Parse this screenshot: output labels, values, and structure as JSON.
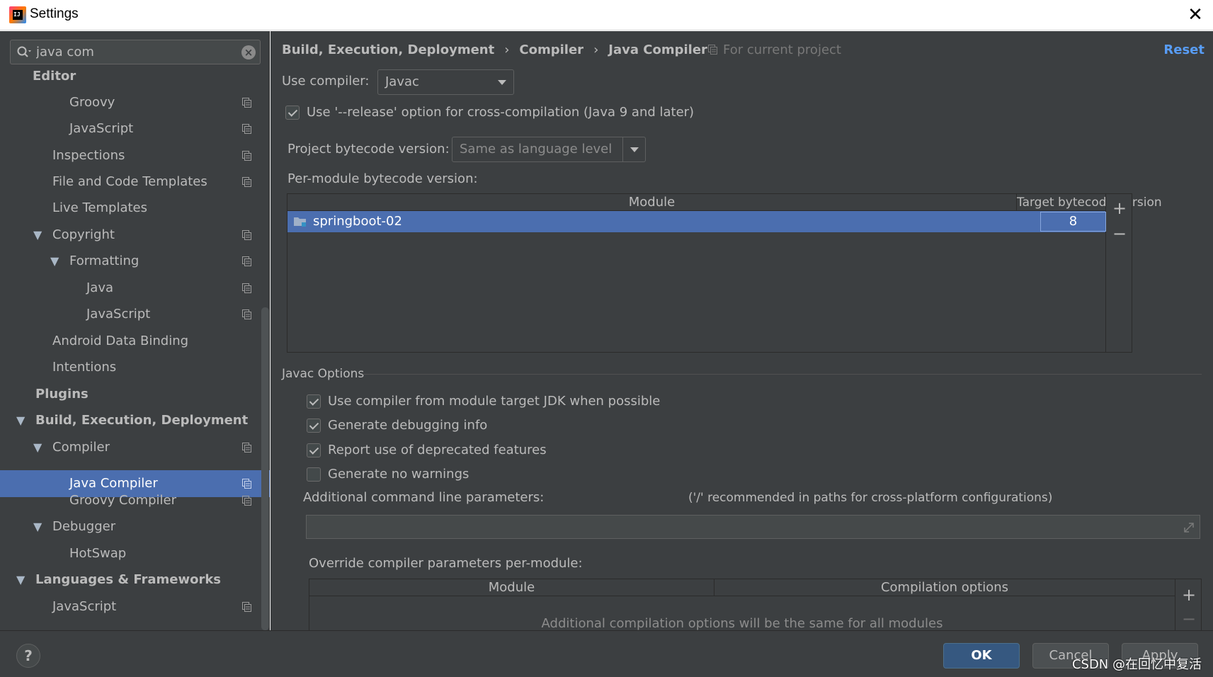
{
  "window": {
    "title": "Settings",
    "close_glyph": "✕"
  },
  "search": {
    "value": "java com",
    "clear_glyph": "×"
  },
  "tree": {
    "editor": "Editor",
    "groovy": "Groovy",
    "javascript1": "JavaScript",
    "inspections": "Inspections",
    "file_templates": "File and Code Templates",
    "live_templates": "Live Templates",
    "copyright": "Copyright",
    "formatting": "Formatting",
    "java": "Java",
    "javascript2": "JavaScript",
    "android_binding": "Android Data Binding",
    "intentions": "Intentions",
    "plugins": "Plugins",
    "build": "Build, Execution, Deployment",
    "compiler": "Compiler",
    "java_compiler": "Java Compiler",
    "groovy_compiler": "Groovy Compiler",
    "debugger": "Debugger",
    "hotswap": "HotSwap",
    "languages": "Languages & Frameworks",
    "javascript3": "JavaScript",
    "expand_glyph": "▼"
  },
  "breadcrumb": {
    "part1": "Build, Execution, Deployment",
    "part2": "Compiler",
    "part3": "Java Compiler",
    "sep": "›"
  },
  "scope_text": "For current project",
  "reset_label": "Reset",
  "compiler": {
    "label": "Use compiler:",
    "value": "Javac"
  },
  "release_option": "Use '--release' option for cross-compilation (Java 9 and later)",
  "bytecode": {
    "label": "Project bytecode version:",
    "value": "Same as language level"
  },
  "per_module": {
    "label": "Per-module bytecode version:",
    "col_module": "Module",
    "col_target": "Target bytecode version",
    "row_module": "springboot-02",
    "row_target": "8",
    "add_glyph": "+",
    "remove_glyph": "−"
  },
  "javac": {
    "title": "Javac Options",
    "opt1": "Use compiler from module target JDK when possible",
    "opt2": "Generate debugging info",
    "opt3": "Report use of deprecated features",
    "opt4": "Generate no warnings",
    "cmd_label": "Additional command line parameters:",
    "cmd_hint": "('/' recommended in paths for cross-platform configurations)"
  },
  "override": {
    "label": "Override compiler parameters per-module:",
    "col_module": "Module",
    "col_options": "Compilation options",
    "empty": "Additional compilation options will be the same for all modules"
  },
  "buttons": {
    "help": "?",
    "ok": "OK",
    "cancel": "Cancel",
    "apply": "Apply"
  },
  "watermark": "CSDN @在回忆中复活"
}
